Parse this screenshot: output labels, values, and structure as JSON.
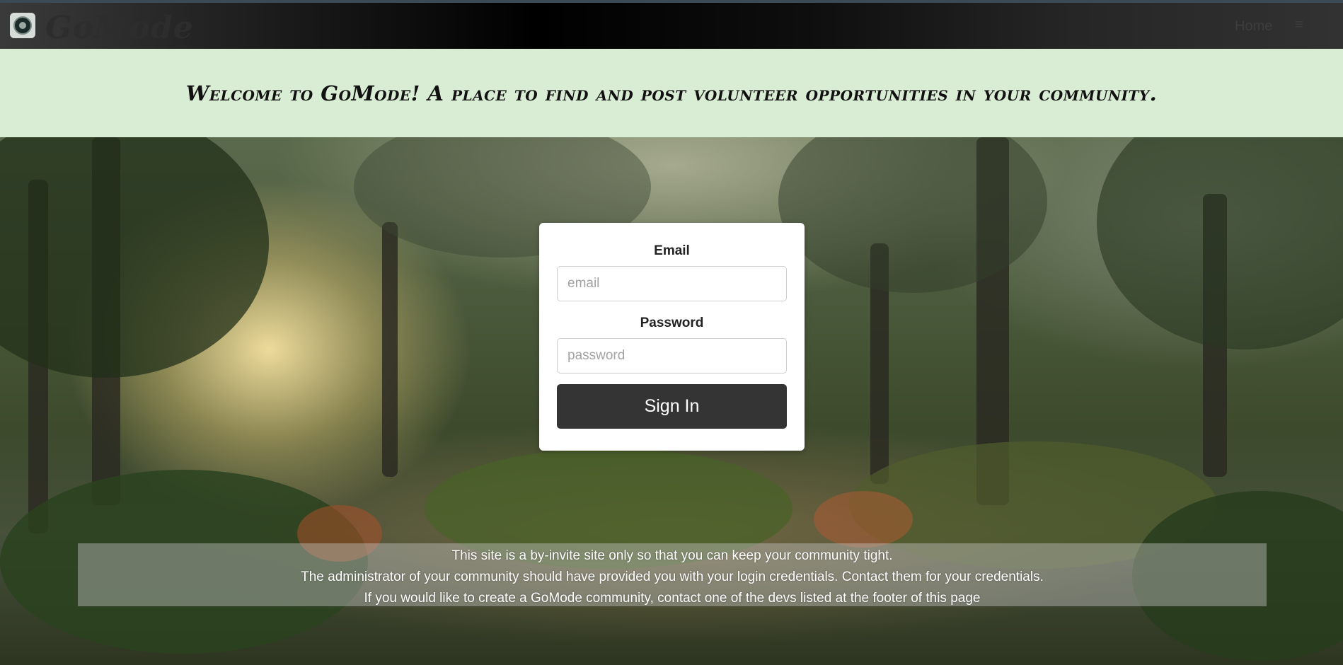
{
  "nav": {
    "brand": "GoMode",
    "home_label": "Home",
    "more_label": "≡"
  },
  "banner": {
    "text": "Welcome to GoMode! A place to find and post volunteer opportunities in your community."
  },
  "login": {
    "email_label": "Email",
    "email_placeholder": "email",
    "password_label": "Password",
    "password_placeholder": "password",
    "submit_label": "Sign In"
  },
  "notice": {
    "lines": [
      "This site is a by-invite site only so that you can keep your community tight.",
      "The administrator of your community should have provided you with your login credentials. Contact them for your credentials.",
      "If you would like to create a GoMode community, contact one of the devs listed at the footer of this page"
    ]
  },
  "colors": {
    "banner_bg": "#d9ecd4",
    "button_bg": "#343434",
    "navbar_bg": "#000000"
  }
}
